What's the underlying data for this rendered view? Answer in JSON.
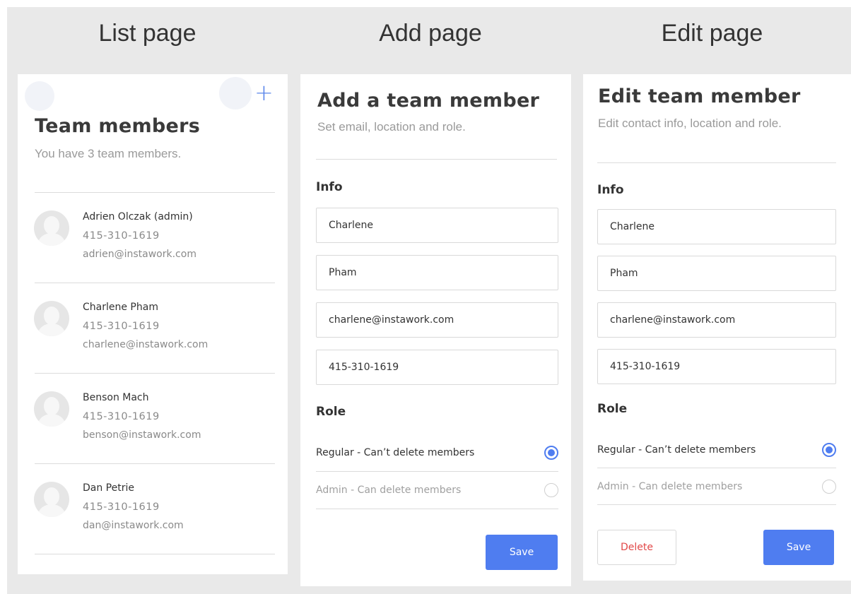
{
  "columns": {
    "list": {
      "header": "List page"
    },
    "add": {
      "header": "Add page"
    },
    "edit": {
      "header": "Edit page"
    }
  },
  "list_page": {
    "title": "Team members",
    "subtitle": "You have 3 team members.",
    "add_icon": "plus-icon",
    "members": [
      {
        "name": "Adrien Olczak (admin)",
        "phone": "415-310-1619",
        "email": "adrien@instawork.com"
      },
      {
        "name": "Charlene Pham",
        "phone": "415-310-1619",
        "email": "charlene@instawork.com"
      },
      {
        "name": "Benson Mach",
        "phone": "415-310-1619",
        "email": "benson@instawork.com"
      },
      {
        "name": "Dan Petrie",
        "phone": "415-310-1619",
        "email": "dan@instawork.com"
      }
    ]
  },
  "add_page": {
    "title": "Add a team member",
    "subtitle": "Set email, location and role.",
    "info_label": "Info",
    "fields": {
      "first_name": "Charlene",
      "last_name": "Pham",
      "email": "charlene@instawork.com",
      "phone": "415-310-1619"
    },
    "role_label": "Role",
    "roles": [
      {
        "label": "Regular - Can’t delete members",
        "selected": true
      },
      {
        "label": "Admin - Can delete members",
        "selected": false
      }
    ],
    "save_label": "Save"
  },
  "edit_page": {
    "title": "Edit team member",
    "subtitle": "Edit contact info, location and role.",
    "info_label": "Info",
    "fields": {
      "first_name": "Charlene",
      "last_name": "Pham",
      "email": "charlene@instawork.com",
      "phone": "415-310-1619"
    },
    "role_label": "Role",
    "roles": [
      {
        "label": "Regular - Can’t delete members",
        "selected": true
      },
      {
        "label": "Admin - Can delete members",
        "selected": false
      }
    ],
    "delete_label": "Delete",
    "save_label": "Save"
  },
  "colors": {
    "accent": "#4f7df0",
    "danger": "#e24848",
    "background": "#e9e9e9"
  }
}
